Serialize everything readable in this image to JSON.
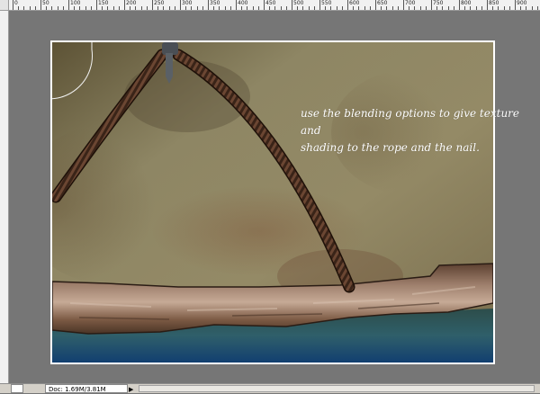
{
  "ruler": {
    "labels": [
      "0",
      "50",
      "100",
      "150",
      "200",
      "250",
      "300",
      "350",
      "400",
      "450",
      "500",
      "550",
      "600",
      "650",
      "700",
      "750",
      "800",
      "850",
      "900"
    ]
  },
  "canvas": {
    "caption_line1": "use the blending options to give texture and",
    "caption_line2": "shading to the rope and the nail.",
    "background_color": "#767676"
  },
  "status": {
    "doc_info": "Doc: 1.69M/3.81M",
    "zoom_icon": "zoom-icon",
    "menu_arrow": "▶"
  }
}
